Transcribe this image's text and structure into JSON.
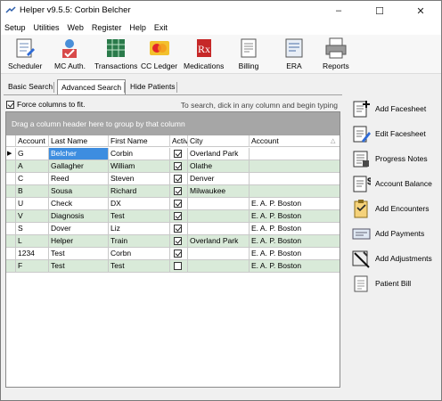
{
  "window": {
    "title": "Helper v9.5.5: Corbin Belcher",
    "controls": {
      "minimize": "–",
      "maximize": "☐",
      "close": "✕"
    }
  },
  "menu": [
    "Setup",
    "Utilities",
    "Web",
    "Register",
    "Help",
    "Exit"
  ],
  "toolbar": [
    {
      "label": "Scheduler",
      "icon": "scheduler-icon"
    },
    {
      "label": "MC Auth.",
      "icon": "mc-auth-icon"
    },
    {
      "label": "Transactions",
      "icon": "transactions-icon"
    },
    {
      "label": "CC Ledger",
      "icon": "cc-ledger-icon"
    },
    {
      "label": "Medications",
      "icon": "medications-icon"
    },
    {
      "label": "Billing",
      "icon": "billing-icon"
    },
    {
      "label": "ERA",
      "icon": "era-icon"
    },
    {
      "label": "Reports",
      "icon": "reports-icon"
    }
  ],
  "tabs": [
    {
      "label": "Basic Search",
      "active": false
    },
    {
      "label": "Advanced Search",
      "active": true
    },
    {
      "label": "Hide Patients",
      "active": false
    }
  ],
  "fit_columns": {
    "label": "Force columns to fit.",
    "checked": true
  },
  "search_hint": "To search, dick in any column and begin typing",
  "grid": {
    "group_prompt": "Drag a column header here to group by that column",
    "headers": [
      "Account",
      "Last Name",
      "First Name",
      "Activ",
      "City",
      "Account"
    ],
    "rows": [
      {
        "account": "G",
        "last": "Belcher",
        "first": "Corbin",
        "active": true,
        "city": "Overland Park",
        "account2": "",
        "current": true
      },
      {
        "account": "A",
        "last": "Gallagher",
        "first": "William",
        "active": true,
        "city": "Olathe",
        "account2": ""
      },
      {
        "account": "C",
        "last": "Reed",
        "first": "Steven",
        "active": true,
        "city": "Denver",
        "account2": ""
      },
      {
        "account": "B",
        "last": "Sousa",
        "first": "Richard",
        "active": true,
        "city": "Milwaukee",
        "account2": ""
      },
      {
        "account": "U",
        "last": "Check",
        "first": "DX",
        "active": true,
        "city": "",
        "account2": "E. A. P. Boston"
      },
      {
        "account": "V",
        "last": "Diagnosis",
        "first": "Test",
        "active": true,
        "city": "",
        "account2": "E. A. P. Boston"
      },
      {
        "account": "S",
        "last": "Dover",
        "first": "Liz",
        "active": true,
        "city": "",
        "account2": "E. A. P. Boston"
      },
      {
        "account": "L",
        "last": "Helper",
        "first": "Train",
        "active": true,
        "city": "Overland Park",
        "account2": "E. A. P. Boston"
      },
      {
        "account": "1234",
        "last": "Test",
        "first": "Corbn",
        "active": true,
        "city": "",
        "account2": "E. A. P. Boston"
      },
      {
        "account": "F",
        "last": "Test",
        "first": "Test",
        "active": false,
        "city": "",
        "account2": "E. A. P. Boston"
      }
    ]
  },
  "side_actions": [
    {
      "label": "Add Facesheet",
      "icon": "add-facesheet-icon"
    },
    {
      "label": "Edit Facesheet",
      "icon": "edit-facesheet-icon"
    },
    {
      "label": "Progress Notes",
      "icon": "progress-notes-icon"
    },
    {
      "label": "Account Balance",
      "icon": "account-balance-icon"
    },
    {
      "label": "Add Encounters",
      "icon": "add-encounters-icon"
    },
    {
      "label": "Add Payments",
      "icon": "add-payments-icon"
    },
    {
      "label": "Add Adjustments",
      "icon": "add-adjustments-icon"
    },
    {
      "label": "Patient Bill",
      "icon": "patient-bill-icon"
    }
  ],
  "colors": {
    "green_row": "#d9ead9",
    "selected_cell": "#3d8de0",
    "group_bar": "#a6a6a6"
  }
}
